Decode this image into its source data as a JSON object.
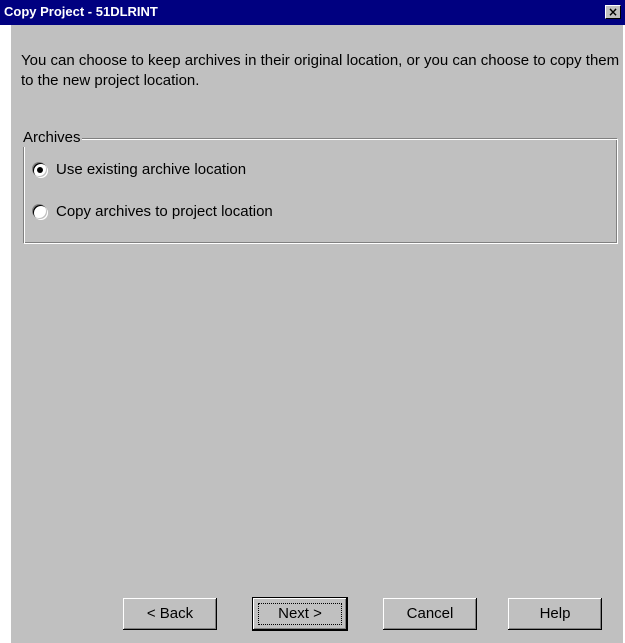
{
  "window": {
    "title": "Copy Project - 51DLRINT",
    "close_glyph": "×"
  },
  "description": "You can choose to keep archives in their original location, or you can choose to copy them to the new project location.",
  "archives_group": {
    "label": "Archives",
    "options": [
      {
        "label": "Use existing archive location",
        "selected": true
      },
      {
        "label": "Copy archives to project location",
        "selected": false
      }
    ]
  },
  "buttons": {
    "back": "< Back",
    "next": "Next >",
    "cancel": "Cancel",
    "help": "Help"
  },
  "colors": {
    "title_bar": "#000080",
    "dialog_face": "#c0c0c0"
  }
}
